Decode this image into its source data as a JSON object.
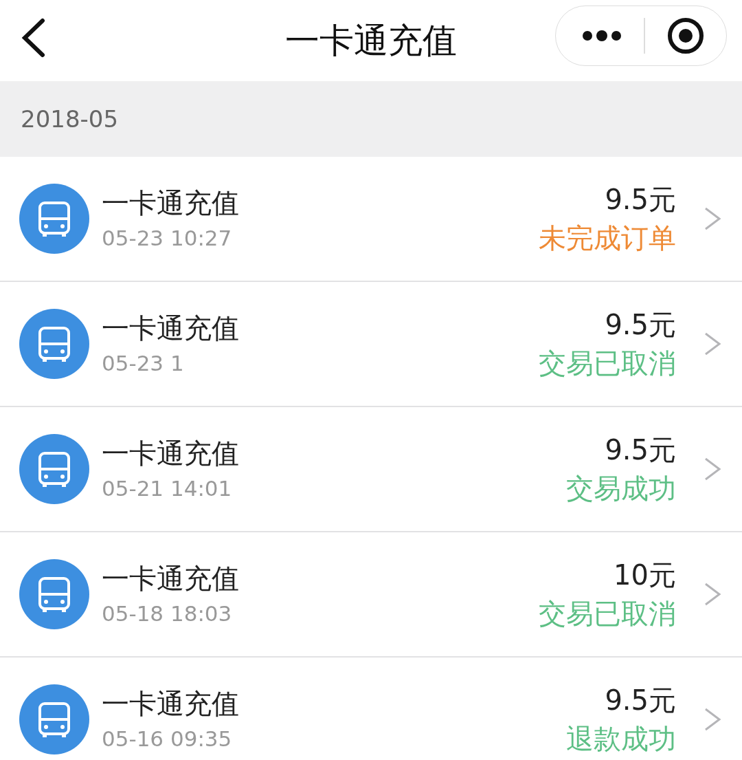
{
  "header": {
    "title": "一卡通充值"
  },
  "section": {
    "label": "2018-05"
  },
  "rows": [
    {
      "title": "一卡通充值",
      "time": "05-23 10:27",
      "amount": "9.5元",
      "status": "未完成订单",
      "color": "#ee8a35"
    },
    {
      "title": "一卡通充值",
      "time": "05-23 1",
      "amount": "9.5元",
      "status": "交易已取消",
      "color": "#5dbf85"
    },
    {
      "title": "一卡通充值",
      "time": "05-21 14:01",
      "amount": "9.5元",
      "status": "交易成功",
      "color": "#5dbf85"
    },
    {
      "title": "一卡通充值",
      "time": "05-18 18:03",
      "amount": "10元",
      "status": "交易已取消",
      "color": "#5dbf85"
    },
    {
      "title": "一卡通充值",
      "time": "05-16 09:35",
      "amount": "9.5元",
      "status": "退款成功",
      "color": "#5dbf85"
    }
  ]
}
